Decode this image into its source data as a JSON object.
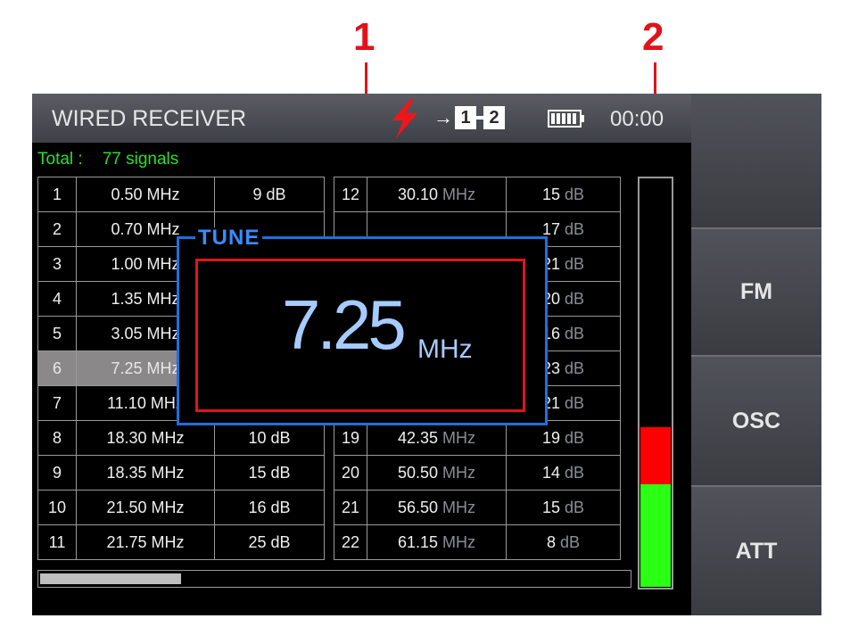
{
  "callouts": [
    {
      "label": "1"
    },
    {
      "label": "2"
    }
  ],
  "header": {
    "title": "WIRED RECEIVER",
    "status_icon": "lightning-bolt-icon",
    "channel_icon": "channel-1-2-icon",
    "channel_a": "1",
    "channel_b": "2",
    "channel_arrow": "→",
    "battery_icon": "battery-icon",
    "clock": "00:00"
  },
  "summary": {
    "label": "Total :",
    "value": "77 signals"
  },
  "unit_mhz": "MHz",
  "unit_db": "dB",
  "signals_left": [
    {
      "idx": "1",
      "freq": "0.50",
      "db": "9"
    },
    {
      "idx": "2",
      "freq": "0.70",
      "db": ""
    },
    {
      "idx": "3",
      "freq": "1.00",
      "db": ""
    },
    {
      "idx": "4",
      "freq": "1.35",
      "db": ""
    },
    {
      "idx": "5",
      "freq": "3.05",
      "db": ""
    },
    {
      "idx": "6",
      "freq": "7.25",
      "db": "",
      "selected": true
    },
    {
      "idx": "7",
      "freq": "11.10",
      "db": ""
    },
    {
      "idx": "8",
      "freq": "18.30",
      "db": "10"
    },
    {
      "idx": "9",
      "freq": "18.35",
      "db": "15"
    },
    {
      "idx": "10",
      "freq": "21.50",
      "db": "16"
    },
    {
      "idx": "11",
      "freq": "21.75",
      "db": "25"
    }
  ],
  "signals_right": [
    {
      "idx": "12",
      "freq": "30.10",
      "db": "15"
    },
    {
      "idx": "",
      "freq": "",
      "db": "17"
    },
    {
      "idx": "",
      "freq": "",
      "db": "21"
    },
    {
      "idx": "",
      "freq": "",
      "db": "20"
    },
    {
      "idx": "",
      "freq": "",
      "db": "16"
    },
    {
      "idx": "",
      "freq": "",
      "db": "23"
    },
    {
      "idx": "",
      "freq": "",
      "db": "21"
    },
    {
      "idx": "19",
      "freq": "42.35",
      "db": "19"
    },
    {
      "idx": "20",
      "freq": "50.50",
      "db": "14"
    },
    {
      "idx": "21",
      "freq": "56.50",
      "db": "15"
    },
    {
      "idx": "22",
      "freq": "61.15",
      "db": "8"
    }
  ],
  "scroll": {
    "position_fraction": 0.0,
    "visible_fraction": 0.24
  },
  "level_meter": {
    "level_fraction": 0.39,
    "red_zone_fraction": 0.14,
    "colors": {
      "high": "#ff0000",
      "normal": "#2bff14"
    }
  },
  "tune": {
    "label": "TUNE",
    "value": "7.25",
    "unit": "MHz"
  },
  "side_buttons": [
    {
      "label": ""
    },
    {
      "label": "FM"
    },
    {
      "label": "OSC"
    },
    {
      "label": "ATT"
    }
  ],
  "colors": {
    "accent_blue": "#1e6fe0",
    "callout_red": "#e0131b",
    "total_green": "#29e02a"
  }
}
